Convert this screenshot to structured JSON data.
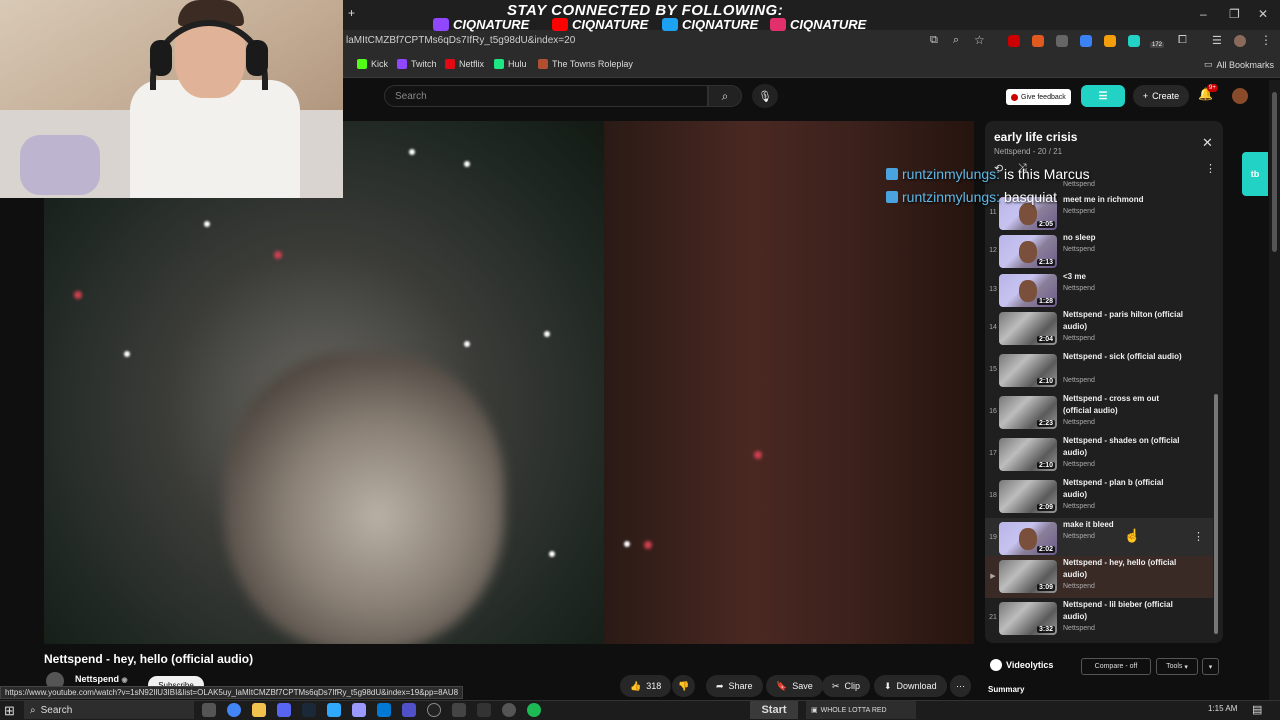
{
  "banner": {
    "title": "STAY CONNECTED BY FOLLOWING:",
    "handles": [
      {
        "platform_icon": "twitch-icon",
        "name": "CIQNATURE",
        "color": "#9146ff"
      },
      {
        "platform_icon": "youtube-icon",
        "name": "CIQNATURE",
        "color": "#ff0000"
      },
      {
        "platform_icon": "twitter-icon",
        "name": "CIQNATURE",
        "color": "#1da1f2"
      },
      {
        "platform_icon": "instagram-icon",
        "name": "CIQNATURE",
        "color": "#e1306c"
      }
    ]
  },
  "browser": {
    "url_fragment": "laMItCMZBf7CPTMs6qDs7IfRy_t5g98dU&index=20",
    "new_tab": "+",
    "bookmarks": [
      {
        "label": "Kick",
        "color": "#53fc18"
      },
      {
        "label": "Twitch",
        "color": "#9146ff"
      },
      {
        "label": "Netflix",
        "color": "#e50914"
      },
      {
        "label": "Hulu",
        "color": "#1ce783"
      },
      {
        "label": "The Towns Roleplay",
        "color": "#b05030"
      }
    ],
    "all_bookmarks": "All Bookmarks",
    "ext_badge": "172",
    "status_url": "https://www.youtube.com/watch?v=1sN92IlU3IBI&list=OLAK5uy_laMItCMZBf7CPTMs6qDs7IfRy_t5g98dU&index=19&pp=8AU8"
  },
  "youtube": {
    "search_placeholder": "Search",
    "feedback_label": "Give feedback",
    "create_label": "Create",
    "notification_count": "9+"
  },
  "chat": [
    {
      "user": "runtzinmylungs:",
      "message": "is this Marcus"
    },
    {
      "user": "runtzinmylungs:",
      "message": "basquiat"
    }
  ],
  "playlist": {
    "title": "early life crisis",
    "subtitle": "Nettspend - 20 / 21",
    "top_partial_channel": "Nettspend",
    "items": [
      {
        "index": "11",
        "title": "meet me in richmond",
        "channel": "Nettspend",
        "duration": "2:05",
        "thumb": "kid"
      },
      {
        "index": "12",
        "title": "no sleep",
        "channel": "Nettspend",
        "duration": "2:13",
        "thumb": "kid"
      },
      {
        "index": "13",
        "title": "<3 me",
        "channel": "Nettspend",
        "duration": "1:28",
        "thumb": "kid"
      },
      {
        "index": "14",
        "title": "Nettspend - paris hilton (official audio)",
        "channel": "Nettspend",
        "duration": "2:04",
        "thumb": "gray"
      },
      {
        "index": "15",
        "title": "Nettspend - sick (official audio)",
        "channel": "Nettspend",
        "duration": "2:10",
        "thumb": "gray"
      },
      {
        "index": "16",
        "title": "Nettspend - cross em out (official audio)",
        "channel": "Nettspend",
        "duration": "2:23",
        "thumb": "gray"
      },
      {
        "index": "17",
        "title": "Nettspend - shades on (official audio)",
        "channel": "Nettspend",
        "duration": "2:10",
        "thumb": "gray"
      },
      {
        "index": "18",
        "title": "Nettspend - plan b (official audio)",
        "channel": "Nettspend",
        "duration": "2:09",
        "thumb": "gray"
      },
      {
        "index": "19",
        "title": "make it bleed",
        "channel": "Nettspend",
        "duration": "2:02",
        "thumb": "kid",
        "state": "hover"
      },
      {
        "index": "▶",
        "title": "Nettspend - hey, hello (official audio)",
        "channel": "Nettspend",
        "duration": "3:09",
        "thumb": "gray",
        "state": "active"
      },
      {
        "index": "21",
        "title": "Nettspend - lil bieber (official audio)",
        "channel": "Nettspend",
        "duration": "3:32",
        "thumb": "gray"
      }
    ]
  },
  "video": {
    "title": "Nettspend - hey, hello (official audio)",
    "channel": "Nettspend",
    "subscribe": "Subscribe",
    "likes": "318",
    "actions": {
      "share": "Share",
      "save": "Save",
      "clip": "Clip",
      "download": "Download"
    }
  },
  "videolytics": {
    "name": "Videolytics",
    "compare": "Compare - off",
    "tools": "Tools",
    "summary": "Summary"
  },
  "side_badge": "tb",
  "taskbar": {
    "search": "Search",
    "start": "Start",
    "now_playing": "WHOLE LOTTA RED",
    "time": "1:15 AM"
  }
}
